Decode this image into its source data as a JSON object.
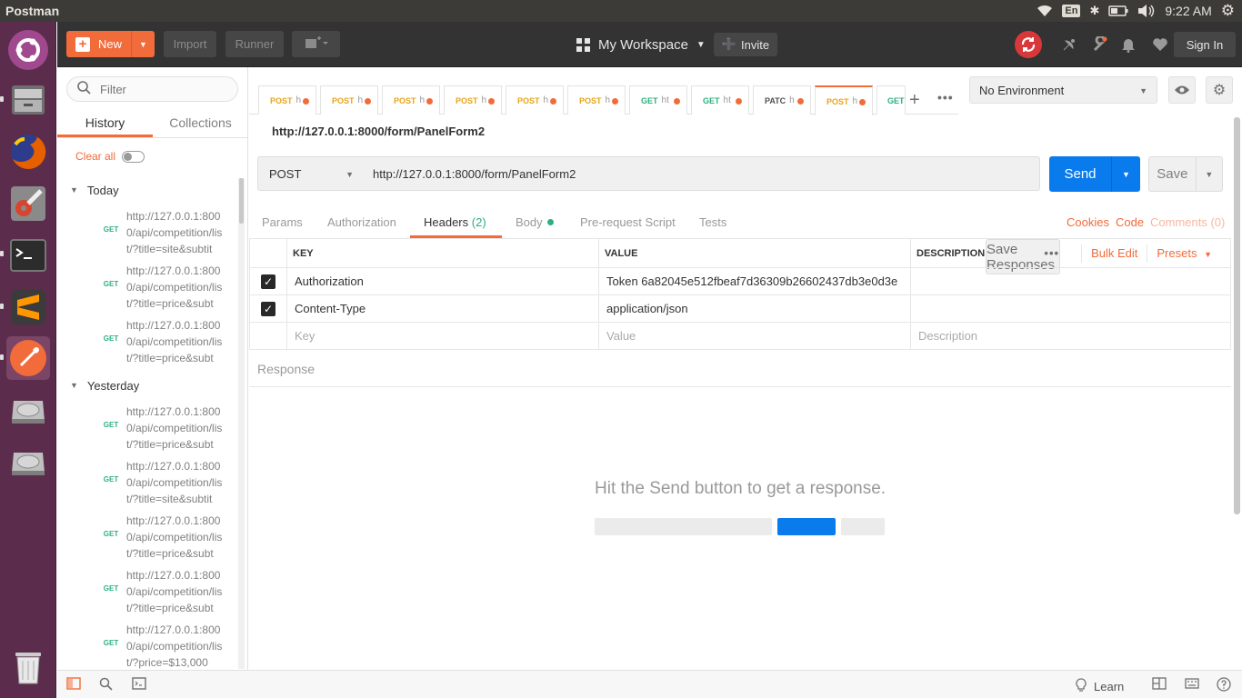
{
  "system_bar": {
    "app_title": "Postman",
    "keyboard_layout": "En",
    "clock": "9:22 AM"
  },
  "launcher": {
    "items": [
      "ubuntu-icon",
      "files-icon",
      "firefox-icon",
      "settings-icon",
      "terminal-icon",
      "sublime-icon",
      "postman-icon",
      "drive-icon",
      "drive-icon",
      "trash-icon"
    ]
  },
  "header": {
    "new_label": "New",
    "import_label": "Import",
    "runner_label": "Runner",
    "workspace_label": "My Workspace",
    "invite_label": "Invite",
    "signin_label": "Sign In"
  },
  "sidebar": {
    "filter_placeholder": "Filter",
    "tabs": [
      "History",
      "Collections"
    ],
    "clear_all": "Clear all",
    "save_responses": "Save Responses",
    "groups": [
      {
        "label": "Today",
        "items": [
          {
            "method": "GET",
            "url": "http://127.0.0.1:8000/api/competition/list/?title=site&subtit"
          },
          {
            "method": "GET",
            "url": "http://127.0.0.1:8000/api/competition/list/?title=price&subt"
          },
          {
            "method": "GET",
            "url": "http://127.0.0.1:8000/api/competition/list/?title=price&subt"
          }
        ]
      },
      {
        "label": "Yesterday",
        "items": [
          {
            "method": "GET",
            "url": "http://127.0.0.1:8000/api/competition/list/?title=price&subt"
          },
          {
            "method": "GET",
            "url": "http://127.0.0.1:8000/api/competition/list/?title=site&subtit"
          },
          {
            "method": "GET",
            "url": "http://127.0.0.1:8000/api/competition/list/?title=price&subt"
          },
          {
            "method": "GET",
            "url": "http://127.0.0.1:8000/api/competition/list/?title=price&subt"
          },
          {
            "method": "GET",
            "url": "http://127.0.0.1:8000/api/competition/list/?price=$13,000"
          }
        ]
      }
    ]
  },
  "request_tabs": [
    {
      "method": "POST",
      "name": "h"
    },
    {
      "method": "POST",
      "name": "h"
    },
    {
      "method": "POST",
      "name": "h"
    },
    {
      "method": "POST",
      "name": "h"
    },
    {
      "method": "POST",
      "name": "h"
    },
    {
      "method": "POST",
      "name": "h"
    },
    {
      "method": "GET",
      "name": "ht"
    },
    {
      "method": "GET",
      "name": "ht"
    },
    {
      "method": "PATC",
      "name": "h"
    },
    {
      "method": "POST",
      "name": "h"
    },
    {
      "method": "GET",
      "name": ""
    }
  ],
  "environment": {
    "selected": "No Environment"
  },
  "request": {
    "breadcrumb": "http://127.0.0.1:8000/form/PanelForm2",
    "method": "POST",
    "url": "http://127.0.0.1:8000/form/PanelForm2",
    "send_label": "Send",
    "save_label": "Save"
  },
  "request_subtabs": {
    "params": "Params",
    "authorization": "Authorization",
    "headers": "Headers",
    "headers_count": "(2)",
    "body": "Body",
    "prerequest": "Pre-request Script",
    "tests": "Tests",
    "cookies": "Cookies",
    "code": "Code",
    "comments": "Comments (0)"
  },
  "headers_table": {
    "col_key": "KEY",
    "col_value": "VALUE",
    "col_description": "DESCRIPTION",
    "bulk_edit": "Bulk Edit",
    "presets": "Presets",
    "rows": [
      {
        "key": "Authorization",
        "value": "Token 6a82045e512fbeaf7d36309b26602437db3e0d3e",
        "description": ""
      },
      {
        "key": "Content-Type",
        "value": "application/json",
        "description": ""
      }
    ],
    "placeholder": {
      "key": "Key",
      "value": "Value",
      "description": "Description"
    }
  },
  "response": {
    "title": "Response",
    "empty_message": "Hit the Send button to get a response."
  },
  "footer": {
    "learn_label": "Learn"
  },
  "colors": {
    "accent": "#f26b3a",
    "send": "#097bed",
    "get": "#2cb07e",
    "post": "#e9a417",
    "launcher": "#5b2c4c"
  }
}
